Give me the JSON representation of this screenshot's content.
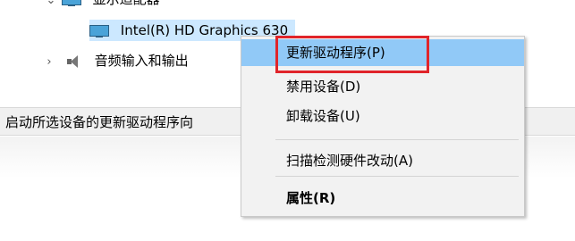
{
  "tree": {
    "display_adapters_label": "显示适配器",
    "intel_device_label": "Intel(R) HD Graphics 630",
    "audio_label": "音频输入和输出"
  },
  "statusbar": {
    "text": "启动所选设备的更新驱动程序向"
  },
  "context_menu": {
    "items": [
      {
        "label": "更新驱动程序(P)"
      },
      {
        "label": "禁用设备(D)"
      },
      {
        "label": "卸载设备(U)"
      },
      {
        "label": "扫描检测硬件改动(A)"
      },
      {
        "label": "属性(R)"
      }
    ]
  },
  "colors": {
    "menu_hover": "#91c9f7",
    "selection": "#cce8ff",
    "highlight_outline": "#e0242a"
  },
  "icons": [
    "chevron-down-icon",
    "monitor-icon",
    "chevron-right-icon",
    "speaker-icon"
  ]
}
